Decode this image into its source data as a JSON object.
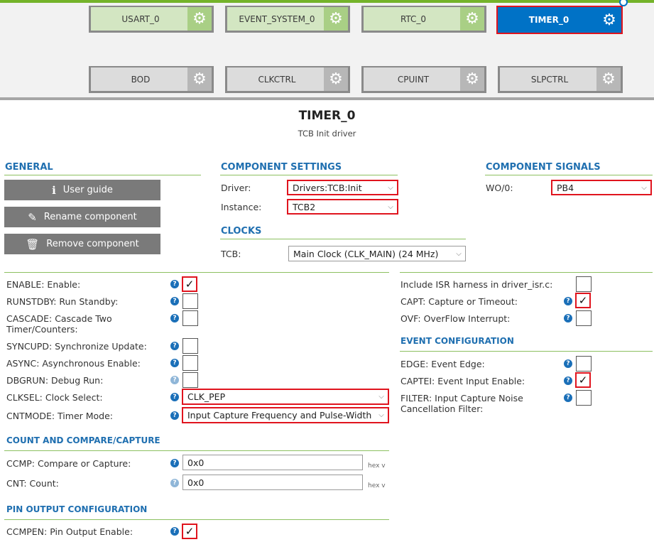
{
  "canvas": {
    "components_row1": [
      {
        "label": "USART_0",
        "style": "green"
      },
      {
        "label": "EVENT_SYSTEM_0",
        "style": "green"
      },
      {
        "label": "RTC_0",
        "style": "green"
      },
      {
        "label": "TIMER_0",
        "style": "selected"
      }
    ],
    "components_row2": [
      {
        "label": "BOD",
        "style": "grey"
      },
      {
        "label": "CLKCTRL",
        "style": "grey"
      },
      {
        "label": "CPUINT",
        "style": "grey"
      },
      {
        "label": "SLPCTRL",
        "style": "grey"
      }
    ]
  },
  "header": {
    "title": "TIMER_0",
    "subtitle": "TCB Init driver"
  },
  "general": {
    "title": "GENERAL",
    "user_guide": "User guide",
    "rename": "Rename component",
    "remove": "Remove component"
  },
  "component_settings": {
    "title": "COMPONENT SETTINGS",
    "driver_label": "Driver:",
    "driver_value": "Drivers:TCB:Init",
    "instance_label": "Instance:",
    "instance_value": "TCB2"
  },
  "clocks": {
    "title": "CLOCKS",
    "tcb_label": "TCB:",
    "tcb_value": "Main Clock (CLK_MAIN) (24 MHz)"
  },
  "component_signals": {
    "title": "COMPONENT SIGNALS",
    "wo_label": "WO/0:",
    "wo_value": "PB4"
  },
  "left_settings": {
    "enable": {
      "label": "ENABLE: Enable:",
      "checked": true
    },
    "runstdby": {
      "label": "RUNSTDBY: Run Standby:",
      "checked": false
    },
    "cascade": {
      "label": "CASCADE: Cascade Two Timer/Counters:",
      "checked": false
    },
    "syncupd": {
      "label": "SYNCUPD: Synchronize Update:",
      "checked": false
    },
    "async": {
      "label": "ASYNC: Asynchronous Enable:",
      "checked": false
    },
    "dbgrun": {
      "label": "DBGRUN: Debug Run:",
      "checked": false
    },
    "clksel": {
      "label": "CLKSEL: Clock Select:",
      "value": "CLK_PEP"
    },
    "cntmode": {
      "label": "CNTMODE: Timer Mode:",
      "value": "Input Capture Frequency and Pulse-Width"
    }
  },
  "count_compare": {
    "title": "COUNT AND COMPARE/CAPTURE",
    "ccmp_label": "CCMP: Compare or Capture:",
    "ccmp_value": "0x0",
    "cnt_label": "CNT: Count:",
    "cnt_value": "0x0",
    "unit": "hex v"
  },
  "pin_output": {
    "title": "PIN OUTPUT CONFIGURATION",
    "ccmpen_label": "CCMPEN: Pin Output Enable:",
    "checked": true
  },
  "right_settings": {
    "isr_label": "Include ISR harness in driver_isr.c:",
    "capt_label": "CAPT: Capture or Timeout:",
    "ovf_label": "OVF: OverFlow Interrupt:"
  },
  "event_config": {
    "title": "EVENT CONFIGURATION",
    "edge_label": "EDGE: Event Edge:",
    "captei_label": "CAPTEI: Event Input Enable:",
    "filter_label": "FILTER: Input Capture Noise Cancellation Filter:"
  },
  "glyphs": {
    "check": "✓",
    "help": "?",
    "gear": "⚙",
    "chevron": "⌵"
  }
}
